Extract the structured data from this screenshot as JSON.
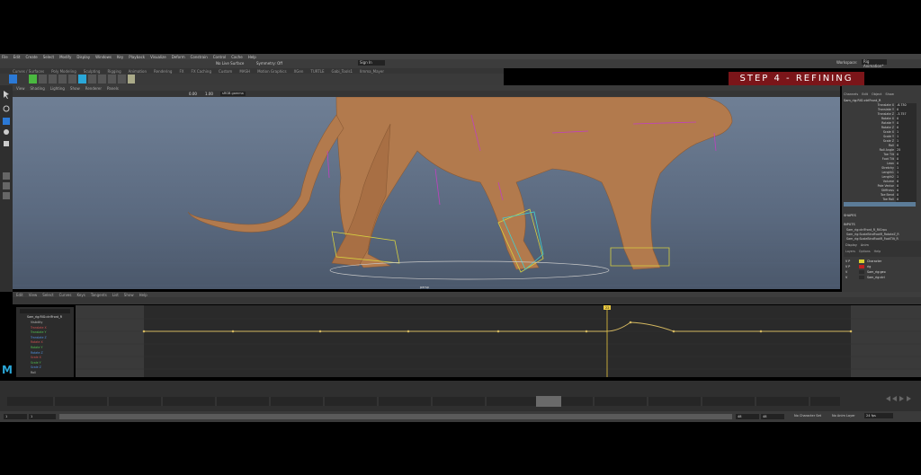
{
  "menubar": [
    "File",
    "Edit",
    "Create",
    "Select",
    "Modify",
    "Display",
    "Windows",
    "Key",
    "Playback",
    "Visualize",
    "Deform",
    "Constrain",
    "Control",
    "Cache",
    "Help"
  ],
  "status_line": {
    "no_live_surface": "No Live Surface",
    "symmetry": "Symmetry: Off",
    "sign_in": "Sign In",
    "workspace_label": "Workspace:",
    "workspace_value": "Rig Animation*"
  },
  "shelf_tabs": [
    "Curves / Surfaces",
    "Poly Modeling",
    "Sculpting",
    "Rigging",
    "Animation",
    "Rendering",
    "FX",
    "FX Caching",
    "Custom",
    "MASH",
    "Motion Graphics",
    "XGen",
    "TURTLE",
    "Gabi_Tools1",
    "Ilmma_Mayer"
  ],
  "step_badge": "STEP 4 - REFINING",
  "panel_menu": [
    "View",
    "Shading",
    "Lighting",
    "Show",
    "Renderer",
    "Panels"
  ],
  "panel_toolbar": {
    "value_1": "0.00",
    "value_2": "1.00",
    "color_space": "sRGB gamma"
  },
  "viewport": {
    "camera": "persp"
  },
  "channel_box": {
    "tabs": [
      "Channels",
      "Edit",
      "Object",
      "Show"
    ],
    "node": "Sam_rig:RIG:ctrlFront_R",
    "attributes": [
      {
        "name": "Translate X",
        "value": "-6.730"
      },
      {
        "name": "Translate Y",
        "value": "0"
      },
      {
        "name": "Translate Z",
        "value": "-3.757"
      },
      {
        "name": "Rotate X",
        "value": "0"
      },
      {
        "name": "Rotate Y",
        "value": "0"
      },
      {
        "name": "Rotate Z",
        "value": "0"
      },
      {
        "name": "Scale X",
        "value": "1"
      },
      {
        "name": "Scale Y",
        "value": "1"
      },
      {
        "name": "Scale Z",
        "value": "1"
      },
      {
        "name": "Roll",
        "value": "0"
      },
      {
        "name": "Roll Angle",
        "value": "25"
      },
      {
        "name": "Toe Tilt",
        "value": "0"
      },
      {
        "name": "Foot Tilt",
        "value": "0"
      },
      {
        "name": "Lean",
        "value": "0"
      },
      {
        "name": "Stretchy",
        "value": "1"
      },
      {
        "name": "Length1",
        "value": "1"
      },
      {
        "name": "Length2",
        "value": "1"
      },
      {
        "name": "Volume",
        "value": "0"
      },
      {
        "name": "Pole Vector",
        "value": "0"
      },
      {
        "name": "Stiffness",
        "value": "0"
      },
      {
        "name": "Toe Bend",
        "value": "0"
      },
      {
        "name": "Toe Roll",
        "value": "0"
      }
    ],
    "shapes_label": "SHAPES",
    "inputs_label": "INPUTS",
    "inputs": [
      "Sam_rig:ctrlFront_R_RIGrpu",
      "Sam_rig:ScaleBindFootR_RotateZ_R",
      "Sam_rig:ScaleBindFootR_FootTilt_R"
    ]
  },
  "layer_editor": {
    "tabs": [
      "Display",
      "Anim"
    ],
    "sub": [
      "Layers",
      "Options",
      "Help"
    ],
    "layers": [
      {
        "label": "V P",
        "name": "Character",
        "color": "#d8d030"
      },
      {
        "label": "V P",
        "name": "rig",
        "color": "#c02020"
      },
      {
        "label": "V",
        "name": "Sam_rig:geo",
        "color": "#2b2b2b"
      },
      {
        "label": "V",
        "name": "Sam_rig:ctrl",
        "color": "#2b2b2b"
      }
    ]
  },
  "graph_editor": {
    "menu": [
      "Edit",
      "View",
      "Select",
      "Curves",
      "Keys",
      "Tangents",
      "List",
      "Show",
      "Help"
    ],
    "outliner_node": "Sam_rig:RIG:ctrlFront_R",
    "outliner_items": [
      {
        "name": "Visibility",
        "color": "#bbbbbb"
      },
      {
        "name": "Translate X",
        "color": "#d05050"
      },
      {
        "name": "Translate Y",
        "color": "#50c050"
      },
      {
        "name": "Translate Z",
        "color": "#5090e0"
      },
      {
        "name": "Rotate X",
        "color": "#d05050"
      },
      {
        "name": "Rotate Y",
        "color": "#50c050"
      },
      {
        "name": "Rotate Z",
        "color": "#5090e0"
      },
      {
        "name": "Scale X",
        "color": "#d05050"
      },
      {
        "name": "Scale Y",
        "color": "#50c050"
      },
      {
        "name": "Scale Z",
        "color": "#5090e0"
      },
      {
        "name": "Roll",
        "color": "#bbbbbb"
      }
    ]
  },
  "timeline": {
    "current_frame": "22",
    "start": "1",
    "end": "48",
    "range_start": "1",
    "range_end": "48",
    "no_character_set": "No Character Set",
    "no_anim_layer": "No Anim Layer",
    "fps": "24 fps"
  },
  "colors": {
    "accent_badge": "#7b1519",
    "viewport_top": "#6f7f95",
    "curve": "#d4b860",
    "current_time": "#e8c840",
    "maya_logo": "#2aa7d8"
  }
}
